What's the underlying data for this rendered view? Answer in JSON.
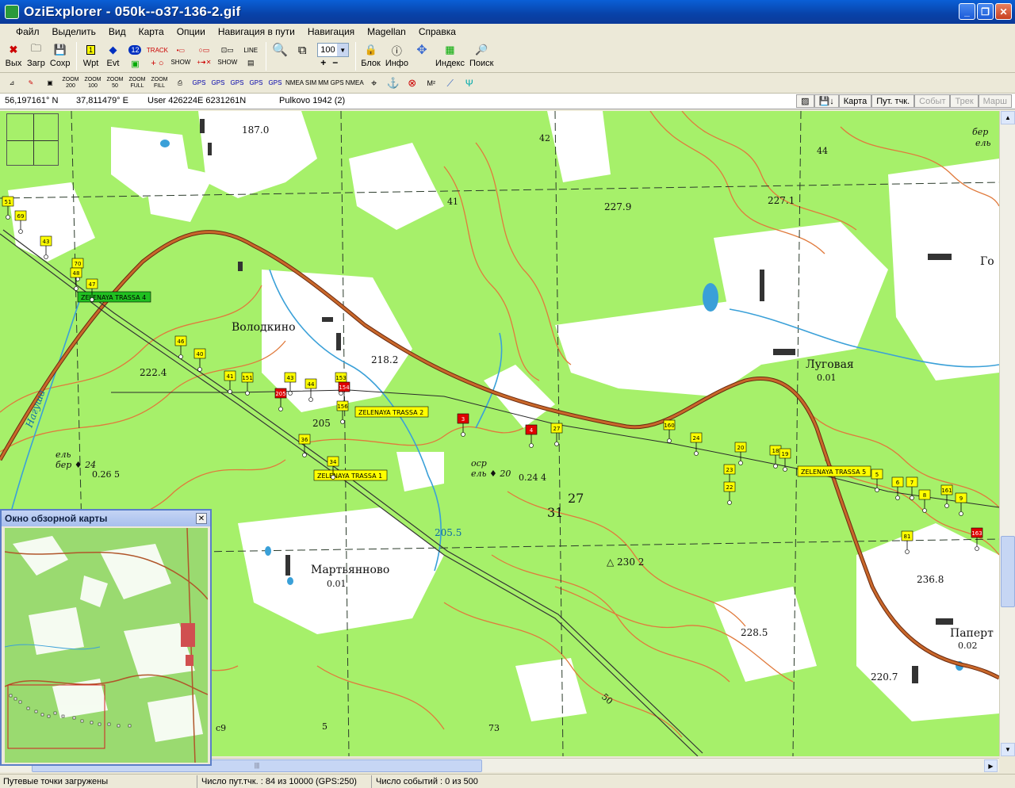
{
  "window": {
    "title": "OziExplorer - 050k--o37-136-2.gif",
    "min_icon": "minimize-icon",
    "max_icon": "maximize-icon",
    "close_icon": "close-icon"
  },
  "menu": [
    "Файл",
    "Выделить",
    "Вид",
    "Карта",
    "Опции",
    "Навигация в пути",
    "Навигация",
    "Magellan",
    "Справка"
  ],
  "toolbar": {
    "exit": "Вых",
    "load": "Загр",
    "save": "Сохр",
    "wpt": "Wpt",
    "evt": "Evt",
    "track_label": "TRACK",
    "show_label": "SHOW",
    "zoom_value": "100",
    "lock": "Блок",
    "info": "Инфо",
    "index": "Индекс",
    "search": "Поиск",
    "wpt_number": "1",
    "evt_number": "12",
    "line_label": "LINE"
  },
  "toolbar2": {
    "zoom200": "ZOOM 200",
    "zoom100": "ZOOM 100",
    "zoom50": "ZOOM 50",
    "zoomfull": "ZOOM FULL",
    "zoomfill": "ZOOM FILL",
    "gps1": "GPS",
    "gps2": "GPS",
    "gps3": "GPS",
    "gps4": "GPS",
    "gps5": "GPS",
    "nmea_sim": "NMEA SIM",
    "mm_gps": "MM GPS",
    "nmea": "NMEA"
  },
  "coords": {
    "lat": "56,197161° N",
    "lon": "37,811479° E",
    "user": "User  426224E   6231261N",
    "datum": "Pulkovo 1942 (2)"
  },
  "right_tabs": [
    {
      "label": "Карта",
      "enabled": true
    },
    {
      "label": "Пут. тчк.",
      "enabled": true
    },
    {
      "label": "Событ",
      "enabled": false
    },
    {
      "label": "Трек",
      "enabled": false
    },
    {
      "label": "Марш",
      "enabled": false
    }
  ],
  "map": {
    "places": [
      {
        "name": "Володкино"
      },
      {
        "name": "Луговая"
      },
      {
        "name": "0.01"
      },
      {
        "name": "Мартьянново"
      },
      {
        "name": "0.01"
      },
      {
        "name": "Паперт"
      },
      {
        "name": "0.02"
      },
      {
        "name": "Го"
      }
    ],
    "elevations": [
      "187.0",
      "227.9",
      "227.1",
      "222.4",
      "218.2",
      "205",
      "205.5",
      "230 2",
      "236.8",
      "228.5",
      "220.7",
      "41",
      "42",
      "44",
      "31",
      "27",
      "4",
      "5",
      "73",
      "c9",
      "50"
    ],
    "forest_notes": [
      "ель",
      "бер",
      "24",
      "0.26",
      "5",
      "оср",
      "ель",
      "20",
      "0.24",
      "4",
      "бер",
      "ель"
    ],
    "waypoints": [
      "51",
      "69",
      "43",
      "70",
      "47",
      "48",
      "46",
      "40",
      "41",
      "151",
      "43",
      "44",
      "153",
      "154",
      "156",
      "205",
      "36",
      "34",
      "27",
      "160",
      "24",
      "20",
      "23",
      "22",
      "18",
      "19",
      "5",
      "6",
      "7",
      "8",
      "161",
      "9",
      "81",
      "163",
      "3",
      "4"
    ],
    "routes": [
      "ZELENAYA TRASSA 4",
      "ZELENAYA TRASSA 2",
      "ZELENAYA TRASSA 1",
      "ZELENAYA TRASSA 5"
    ],
    "river": "Нагуша"
  },
  "overview": {
    "title": "Окно обзорной карты"
  },
  "status": {
    "left": "Путевые точки загружены",
    "count": "Число пут.тчк. : 84 из 10000  (GPS:250)",
    "events": "Число событий : 0 из 500"
  },
  "colors": {
    "forest": "#a6f06a",
    "open": "#ffffff",
    "road": "#b0562a",
    "contour": "#e07a3c",
    "water": "#3aa0d8",
    "waypoint": "#ffff00",
    "event": "#e00000",
    "route_label": "#20c020"
  }
}
